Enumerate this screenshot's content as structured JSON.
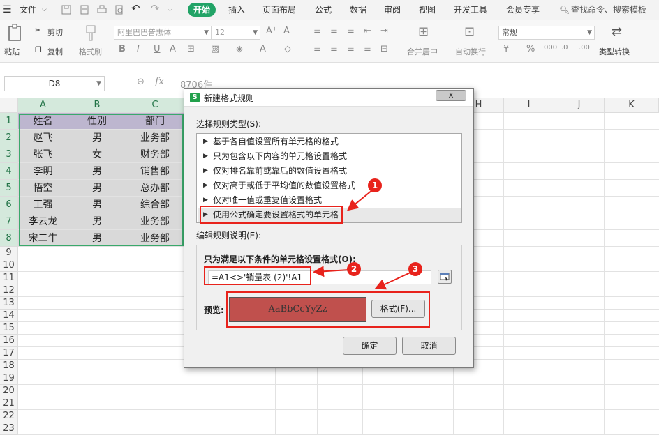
{
  "menu": {
    "file": "文件",
    "tabs": [
      "开始",
      "插入",
      "页面布局",
      "公式",
      "数据",
      "审阅",
      "视图",
      "开发工具",
      "会员专享"
    ],
    "search": "查找命令、搜索模板"
  },
  "ribbon": {
    "paste": "粘贴",
    "cut": "剪切",
    "copy": "复制",
    "format_painter": "格式刷",
    "font_name": "阿里巴巴普惠体",
    "font_size": "12",
    "merge": "合并居中",
    "wrap": "自动换行",
    "number_format": "常规",
    "convert": "类型转换"
  },
  "formula_bar": {
    "name_box": "D8",
    "fx": "fx",
    "value": "8706件"
  },
  "sheet": {
    "columns": [
      "A",
      "B",
      "C",
      "H",
      "I",
      "J",
      "K"
    ],
    "rows": [
      "1",
      "2",
      "3",
      "4",
      "5",
      "6",
      "7",
      "8",
      "9",
      "10",
      "11",
      "12",
      "13",
      "14",
      "15",
      "16",
      "17",
      "18",
      "19",
      "20",
      "21",
      "22",
      "23"
    ],
    "headers": [
      "姓名",
      "性别",
      "部门"
    ],
    "data": [
      [
        "赵飞",
        "男",
        "业务部"
      ],
      [
        "张飞",
        "女",
        "财务部"
      ],
      [
        "李明",
        "男",
        "销售部"
      ],
      [
        "悟空",
        "男",
        "总办部"
      ],
      [
        "王强",
        "男",
        "综合部"
      ],
      [
        "李云龙",
        "男",
        "业务部"
      ],
      [
        "宋二牛",
        "男",
        "业务部"
      ]
    ]
  },
  "dialog": {
    "title": "新建格式规则",
    "close": "x",
    "select_rule_type": "选择规则类型(S):",
    "rules": [
      "基于各自值设置所有单元格的格式",
      "只为包含以下内容的单元格设置格式",
      "仅对排名靠前或靠后的数值设置格式",
      "仅对高于或低于平均值的数值设置格式",
      "仅对唯一值或重复值设置格式",
      "使用公式确定要设置格式的单元格"
    ],
    "edit_rule_desc": "编辑规则说明(E):",
    "formula_label": "只为满足以下条件的单元格设置格式(O):",
    "formula_value": "=A1<>'销量表 (2)'!A1",
    "preview_label": "预览:",
    "preview_text": "AaBbCcYyZz",
    "format_button": "格式(F)...",
    "ok": "确定",
    "cancel": "取消"
  },
  "annotations": [
    "1",
    "2",
    "3"
  ],
  "colors": {
    "accent": "#21a366",
    "header_fill": "#bdb6cf",
    "data_fill": "#d9d9d9",
    "preview_fill": "#c0504d",
    "annotation_red": "#e8231c"
  }
}
